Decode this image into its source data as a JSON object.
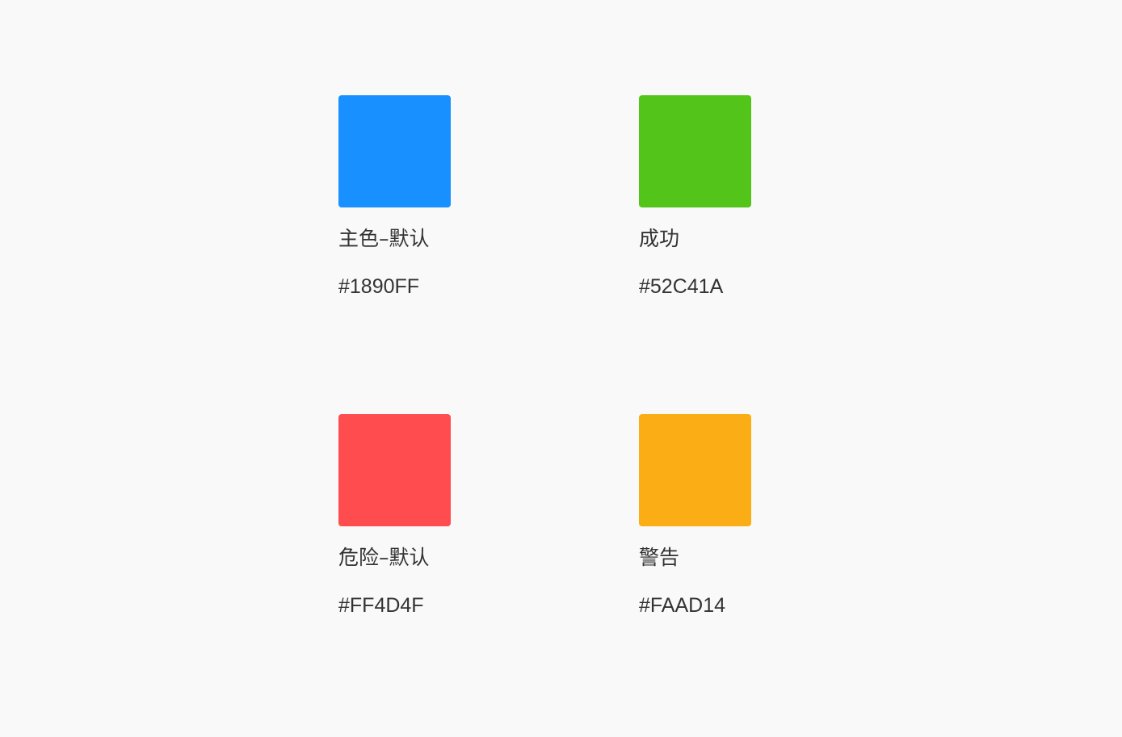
{
  "swatches": [
    {
      "name": "主色–默认",
      "hex": "#1890FF",
      "color": "#1890FF"
    },
    {
      "name": "成功",
      "hex": "#52C41A",
      "color": "#52C41A"
    },
    {
      "name": "危险–默认",
      "hex": "#FF4D4F",
      "color": "#FF4D4F"
    },
    {
      "name": "警告",
      "hex": "#FAAD14",
      "color": "#FAAD14"
    }
  ]
}
